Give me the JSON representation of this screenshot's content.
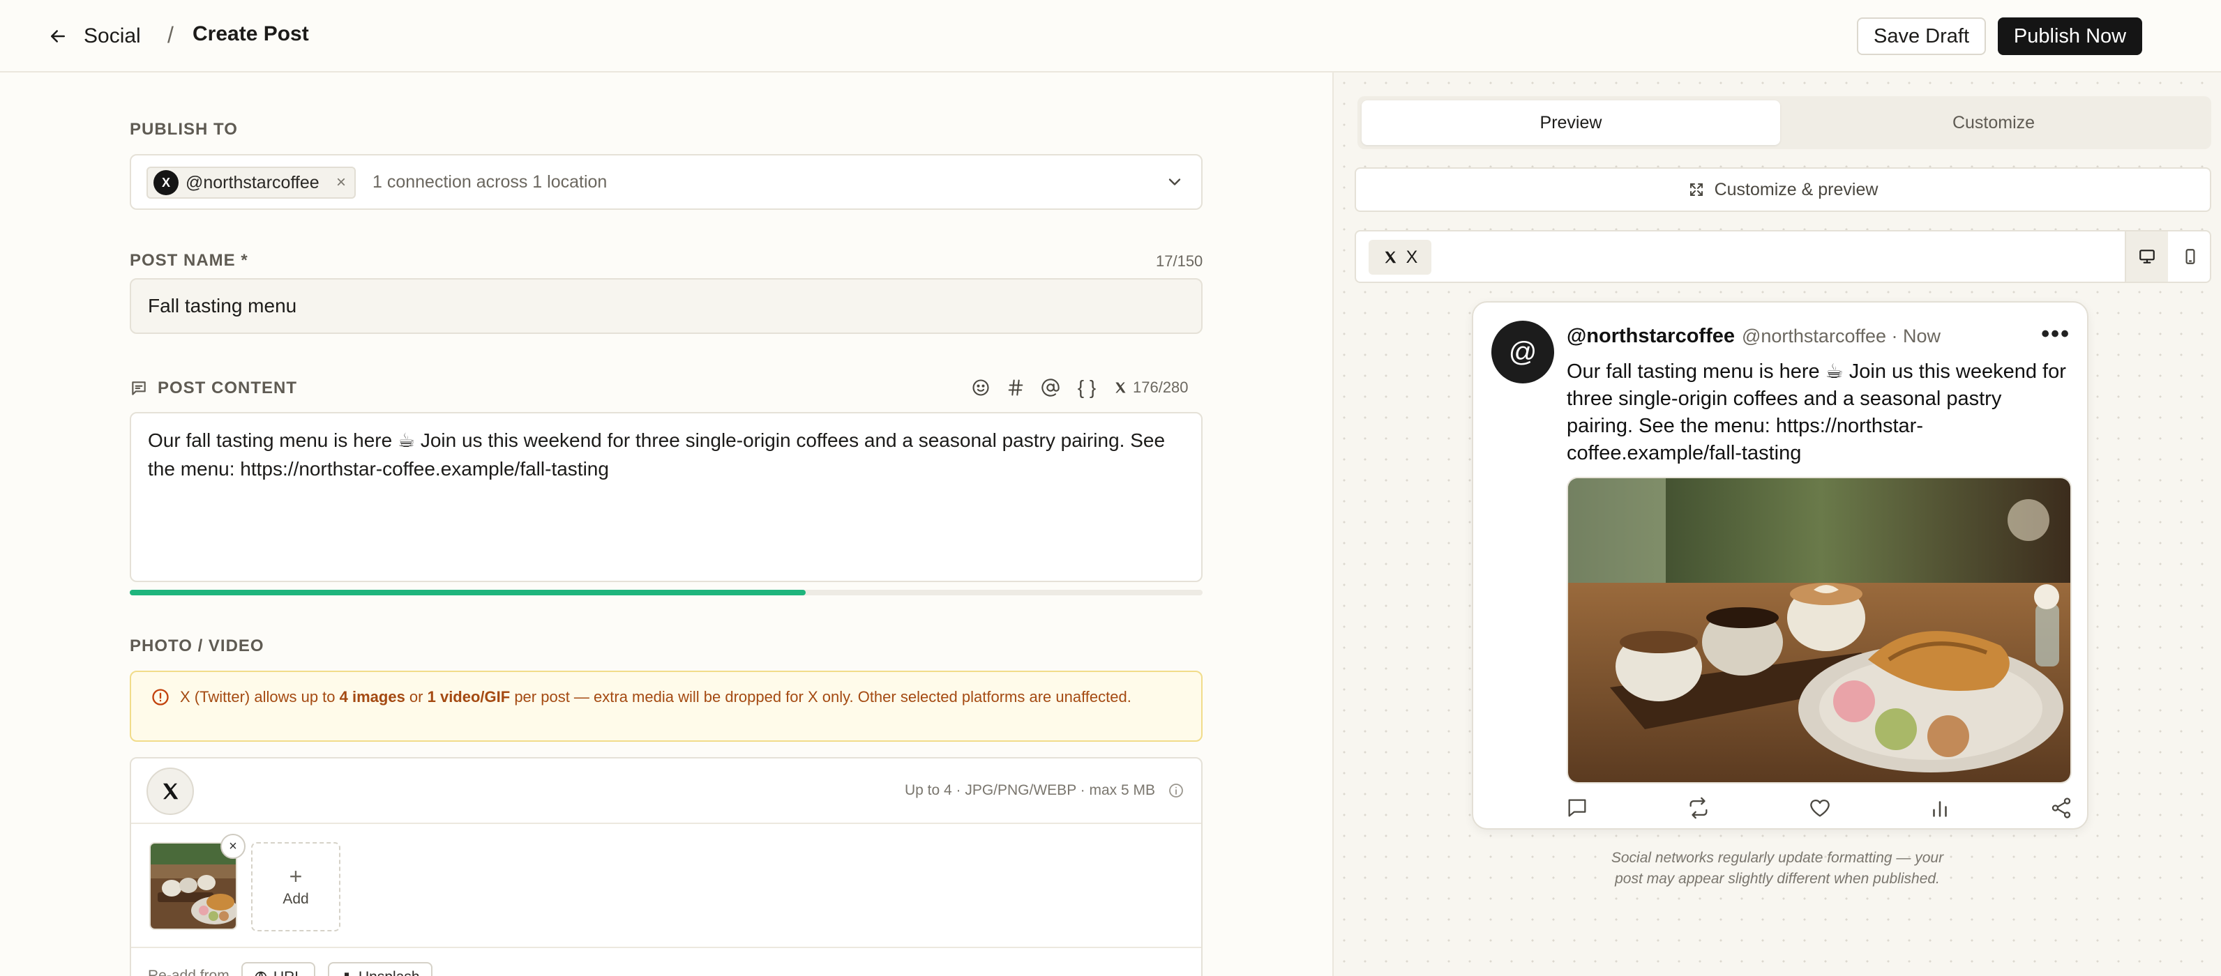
{
  "header": {
    "back_label": "Social",
    "separator": "/",
    "title": "Create Post",
    "save_draft": "Save Draft",
    "publish_now": "Publish Now"
  },
  "publish_to": {
    "label": "PUBLISH TO",
    "account": "@northstarcoffee",
    "account_icon": "X",
    "remove": "×",
    "summary": "1 connection across 1 location"
  },
  "post_name": {
    "label": "POST NAME *",
    "counter": "17/150",
    "value": "Fall tasting menu"
  },
  "post_content": {
    "label": "POST CONTENT",
    "braces": "{ }",
    "counter": "176/280",
    "progress": 0.63,
    "text": "Our fall tasting menu is here ☕  Join us this weekend for three single-origin coffees and a seasonal pastry pairing. See the menu: https://northstar-coffee.example/fall-tasting"
  },
  "media": {
    "label": "PHOTO / VIDEO",
    "warning_pre": "X (Twitter) allows up to ",
    "warning_b1": "4 images",
    "warning_mid": " or ",
    "warning_b2": "1 video/GIF",
    "warning_post": " per post — extra media will be dropped for X only. Other selected platforms are unaffected.",
    "limits": "Up to 4 · JPG/PNG/WEBP · max 5 MB",
    "thumb_close": "×",
    "add_plus": "+",
    "add_label": "Add",
    "readd_label": "Re-add from",
    "url_btn": "URL",
    "unsplash_btn": "Unsplash"
  },
  "preview": {
    "tab_preview": "Preview",
    "tab_customize": "Customize",
    "customize_preview": "Customize & preview",
    "network_chip": "X",
    "tweet": {
      "avatar": "@",
      "name": "@northstarcoffee",
      "meta": "@northstarcoffee · Now",
      "more": "•••",
      "text": "Our fall tasting menu is here ☕  Join us this weekend for three single-origin coffees and a seasonal pastry pairing. See the menu: https://northstar-coffee.example/fall-tasting"
    },
    "disclaimer": "Social networks regularly update formatting — your post may appear slightly different when published."
  },
  "colors": {
    "accent_green": "#1fb57d",
    "warning_text": "#a44a12",
    "warning_bg": "#fffbea",
    "primary_button": "#151515"
  },
  "icons": [
    "arrow-left-icon",
    "chevron-down-icon",
    "comment-icon",
    "emoji-icon",
    "hashtag-icon",
    "mention-icon",
    "x-logo-icon",
    "alert-circle-icon",
    "info-icon",
    "globe-icon",
    "expand-icon",
    "desktop-icon",
    "mobile-icon",
    "reply-icon",
    "repost-icon",
    "like-icon",
    "stats-icon",
    "share-icon"
  ]
}
